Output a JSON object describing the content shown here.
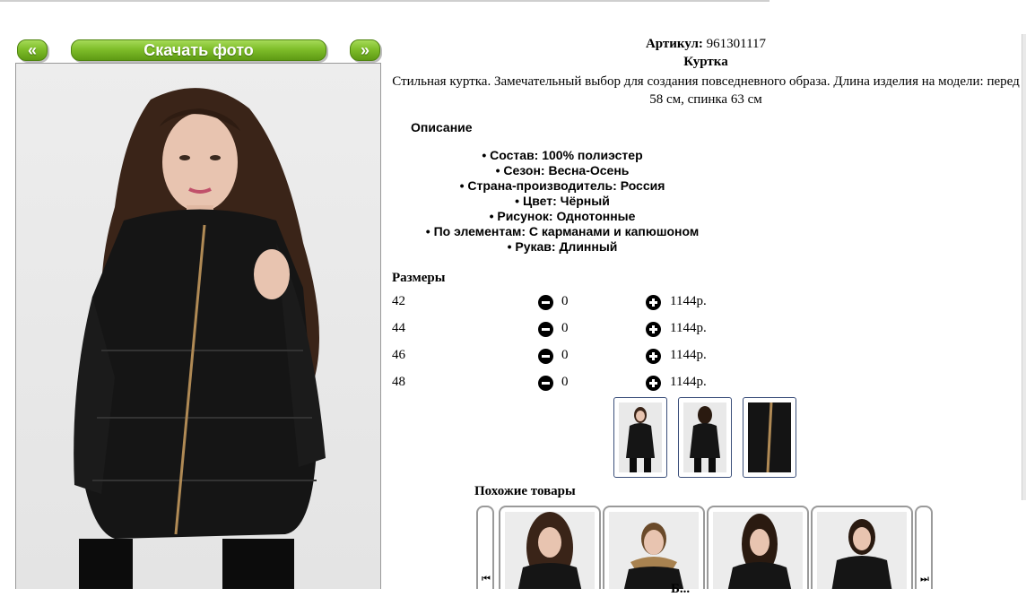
{
  "nav": {
    "prev_label": "«",
    "next_label": "»",
    "download_label": "Скачать фото"
  },
  "product": {
    "article_label": "Артикул:",
    "article_value": "961301117",
    "title": "Куртка",
    "description": "Стильная куртка. Замечательный выбор для создания повседневного образа. Длина изделия на модели: перед 58 см, спинка 63 см",
    "description_title": "Описание",
    "properties": [
      "Состав: 100% полиэстер",
      "Сезон: Весна-Осень",
      "Страна-производитель: Россия",
      "Цвет: Чёрный",
      "Рисунок: Однотонные",
      "По элементам: С карманами и капюшоном",
      "Рукав: Длинный"
    ]
  },
  "sizes": {
    "title": "Размеры",
    "rows": [
      {
        "size": "42",
        "qty": "0",
        "price": "1144р."
      },
      {
        "size": "44",
        "qty": "0",
        "price": "1144р."
      },
      {
        "size": "46",
        "qty": "0",
        "price": "1144р."
      },
      {
        "size": "48",
        "qty": "0",
        "price": "1144р."
      }
    ]
  },
  "similar": {
    "title": "Похожие товары",
    "truncated_text": "Б..."
  },
  "colors": {
    "button_green": "#7fbe2a",
    "jacket": "#111111",
    "hair": "#3a2418"
  }
}
